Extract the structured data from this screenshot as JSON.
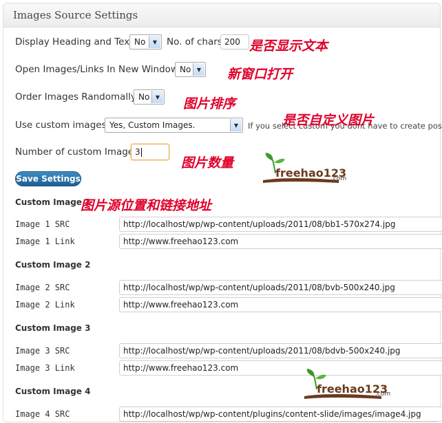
{
  "panel": {
    "title": "Images Source Settings"
  },
  "settings": {
    "heading_label": "Display Heading and Text?",
    "heading_value": "No",
    "chars_label": "No. of chars:",
    "chars_value": "200",
    "new_window_label": "Open Images/Links In New Window?",
    "new_window_value": "No",
    "random_label": "Order Images Randomally?",
    "random_value": "No",
    "custom_label": "Use custom images?",
    "custom_value": "Yes, Custom Images.",
    "custom_hint": "If you select custom you dont have to create posts.",
    "count_label": "Number of custom Images",
    "count_value": "3"
  },
  "save_label": "Save Settings",
  "annotations": {
    "show_text": "是否显示文本",
    "new_window": "新窗口打开",
    "sort": "图片排序",
    "custom": "是否自定义图片",
    "count": "图片数量",
    "source": "图片源位置和链接地址"
  },
  "logo": {
    "word": "freehao123",
    "suffix": ".com"
  },
  "custom_images": [
    {
      "title": "Custom Image 1",
      "src_label": "Image 1 SRC",
      "src": "http://localhost/wp/wp-content/uploads/2011/08/bb1-570x274.jpg",
      "link_label": "Image 1 Link",
      "link": "http://www.freehao123.com"
    },
    {
      "title": "Custom Image 2",
      "src_label": "Image 2 SRC",
      "src": "http://localhost/wp/wp-content/uploads/2011/08/bvb-500x240.jpg",
      "link_label": "Image 2 Link",
      "link": "http://www.freehao123.com"
    },
    {
      "title": "Custom Image 3",
      "src_label": "Image 3 SRC",
      "src": "http://localhost/wp/wp-content/uploads/2011/08/bdvb-500x240.jpg",
      "link_label": "Image 3 Link",
      "link": "http://www.freehao123.com"
    },
    {
      "title": "Custom Image 4",
      "src_label": "Image 4 SRC",
      "src": "http://localhost/wp/wp-content/plugins/content-slide/images/image4.jpg"
    }
  ],
  "colors": {
    "annotation": "#e0002a",
    "button": "#2a6fa5",
    "logo_brown": "#6b3a1e",
    "logo_green": "#3a9a2a"
  }
}
